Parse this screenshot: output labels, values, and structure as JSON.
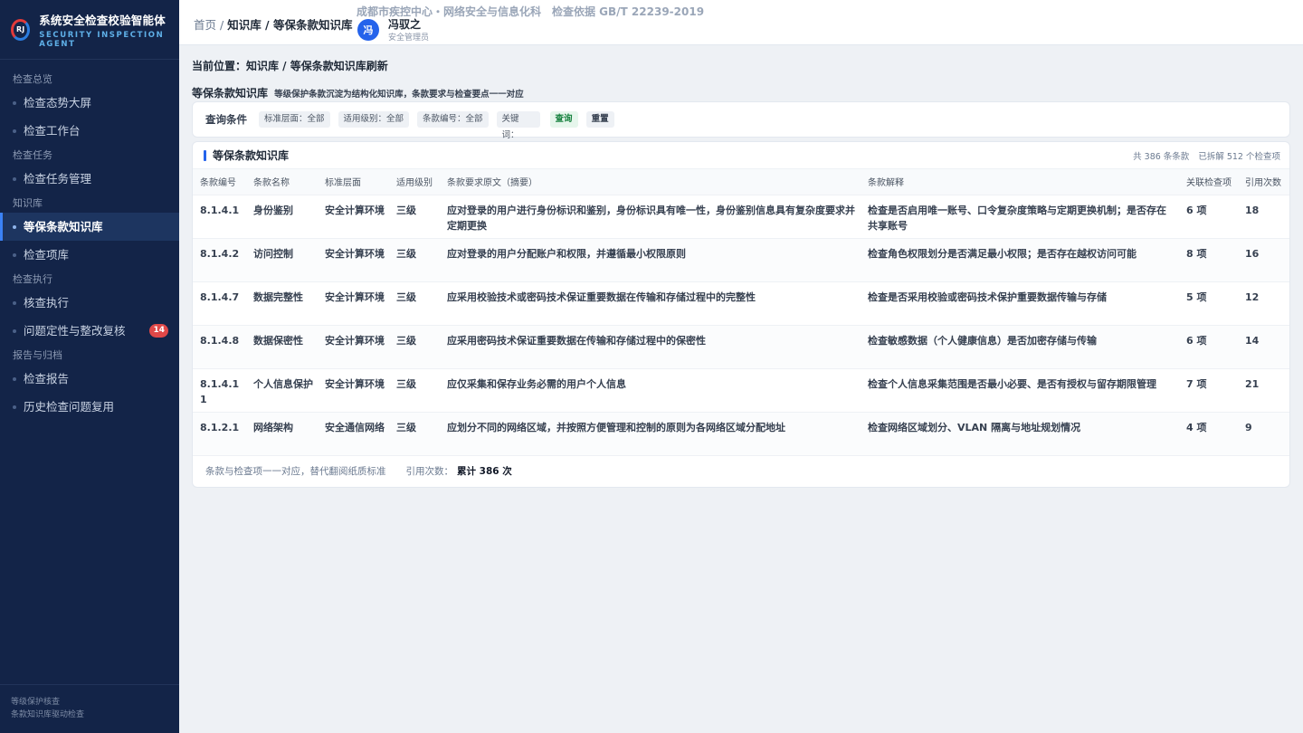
{
  "brand": {
    "logo_text": "RJ",
    "title": "系统安全检查校验智能体",
    "subtitle": "SECURITY INSPECTION AGENT"
  },
  "sidebar": {
    "groups": [
      {
        "label": "检查总览",
        "items": [
          {
            "label": "检查态势大屏"
          },
          {
            "label": "检查工作台"
          }
        ]
      },
      {
        "label": "检查任务",
        "items": [
          {
            "label": "检查任务管理"
          }
        ]
      },
      {
        "label": "知识库",
        "items": [
          {
            "label": "等保条款知识库",
            "active": true
          },
          {
            "label": "检查项库"
          }
        ]
      },
      {
        "label": "检查执行",
        "items": [
          {
            "label": "核查执行"
          },
          {
            "label": "问题定性与整改复核",
            "badge": "14"
          }
        ]
      },
      {
        "label": "报告与归档",
        "items": [
          {
            "label": "检查报告"
          },
          {
            "label": "历史检查问题复用"
          }
        ]
      }
    ],
    "footer": {
      "line1": "等级保护核查",
      "line2": "条款知识库驱动检查"
    }
  },
  "topbar": {
    "breadcrumb": {
      "home": "首页",
      "sep1": " / ",
      "section": "知识库",
      "sep2": " / ",
      "current": "等保条款知识库"
    },
    "org_line": "成都市疾控中心・网络安全与信息化科　检查依据 GB/T 22239-2019",
    "user": {
      "avatar_char": "冯",
      "name": "冯驭之",
      "role": "安全管理员"
    }
  },
  "main": {
    "location": "当前位置：知识库 / 等保条款知识库刷新",
    "kb_title": "等保条款知识库",
    "kb_desc": "等级保护条款沉淀为结构化知识库，条款要求与检查要点一一对应",
    "filter": {
      "label": "查询条件",
      "chips": [
        "标准层面：全部",
        "适用级别：全部",
        "条款编号：全部",
        "关键词："
      ],
      "query_button": "查询",
      "reset_button": "重置"
    },
    "panel": {
      "title": "等保条款知识库",
      "meta_total": "共 386 条条款",
      "meta_split": "已拆解 512 个检查项",
      "columns": [
        "条款编号",
        "条款名称",
        "标准层面",
        "适用级别",
        "条款要求原文（摘要）",
        "条款解释",
        "关联检查项",
        "引用次数"
      ],
      "rows": [
        {
          "code": "8.1.4.1",
          "name": "身份鉴别",
          "layer": "安全计算环境",
          "level": "三级",
          "requirement": "应对登录的用户进行身份标识和鉴别，身份标识具有唯一性，身份鉴别信息具有复杂度要求并定期更换",
          "explain": "检查是否启用唯一账号、口令复杂度策略与定期更换机制；是否存在共享账号",
          "items": "6 项",
          "refs": "18"
        },
        {
          "code": "8.1.4.2",
          "name": "访问控制",
          "layer": "安全计算环境",
          "level": "三级",
          "requirement": "应对登录的用户分配账户和权限，并遵循最小权限原则",
          "explain": "检查角色权限划分是否满足最小权限；是否存在越权访问可能",
          "items": "8 项",
          "refs": "16"
        },
        {
          "code": "8.1.4.7",
          "name": "数据完整性",
          "layer": "安全计算环境",
          "level": "三级",
          "requirement": "应采用校验技术或密码技术保证重要数据在传输和存储过程中的完整性",
          "explain": "检查是否采用校验或密码技术保护重要数据传输与存储",
          "items": "5 项",
          "refs": "12"
        },
        {
          "code": "8.1.4.8",
          "name": "数据保密性",
          "layer": "安全计算环境",
          "level": "三级",
          "requirement": "应采用密码技术保证重要数据在传输和存储过程中的保密性",
          "explain": "检查敏感数据（个人健康信息）是否加密存储与传输",
          "items": "6 项",
          "refs": "14"
        },
        {
          "code": "8.1.4.11",
          "name": "个人信息保护",
          "layer": "安全计算环境",
          "level": "三级",
          "requirement": "应仅采集和保存业务必需的用户个人信息",
          "explain": "检查个人信息采集范围是否最小必要、是否有授权与留存期限管理",
          "items": "7 项",
          "refs": "21"
        },
        {
          "code": "8.1.2.1",
          "name": "网络架构",
          "layer": "安全通信网络",
          "level": "三级",
          "requirement": "应划分不同的网络区域，并按照方便管理和控制的原则为各网络区域分配地址",
          "explain": "检查网络区域划分、VLAN 隔离与地址规划情况",
          "items": "4 项",
          "refs": "9"
        }
      ],
      "footer_note": "条款与检查项一一对应，替代翻阅纸质标准",
      "footer_label": "引用次数：",
      "footer_total": "累计 386 次"
    }
  }
}
